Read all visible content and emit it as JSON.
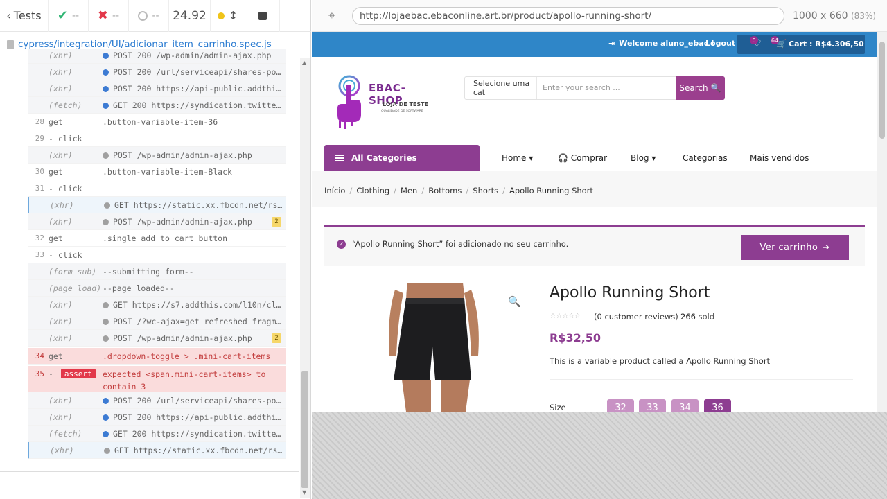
{
  "reporter": {
    "tests_label": "Tests",
    "passed": "--",
    "failed": "--",
    "pending": "--",
    "duration": "24.92",
    "spec_path": "cypress/integration/UI/adicionar_item_carrinho.spec.js",
    "rows": [
      {
        "num": "",
        "name": "(xhr)",
        "msg": "POST 200 /wp-admin/admin-ajax.php",
        "dot": "blue",
        "style": "grey"
      },
      {
        "num": "",
        "name": "(xhr)",
        "msg": "POST 200 /url/serviceapi/shares-post.json...",
        "dot": "blue",
        "style": "grey"
      },
      {
        "num": "",
        "name": "(xhr)",
        "msg": "POST 200 https://api-public.addthis.com/u...",
        "dot": "blue",
        "style": "grey"
      },
      {
        "num": "",
        "name": "(fetch)",
        "msg": "GET 200 https://syndication.twitte...",
        "dot": "blue",
        "style": "grey"
      },
      {
        "num": "28",
        "name": "get",
        "msg": ".button-variable-item-36",
        "dot": "",
        "style": "plain"
      },
      {
        "num": "29",
        "name": " - click",
        "msg": "",
        "dot": "",
        "style": "plain"
      },
      {
        "num": "",
        "name": "(xhr)",
        "msg": "POST /wp-admin/admin-ajax.php",
        "dot": "gray",
        "style": "grey"
      },
      {
        "num": "30",
        "name": "get",
        "msg": ".button-variable-item-Black",
        "dot": "",
        "style": "plain"
      },
      {
        "num": "31",
        "name": " - click",
        "msg": "",
        "dot": "",
        "style": "plain"
      },
      {
        "num": "",
        "name": "(xhr)",
        "msg": "GET https://static.xx.fbcdn.net/rs...",
        "dot": "gray",
        "style": "pending"
      },
      {
        "num": "",
        "name": "(xhr)",
        "msg": "POST /wp-admin/admin-ajax.php",
        "dot": "gray",
        "style": "grey",
        "badge": "2"
      },
      {
        "num": "32",
        "name": "get",
        "msg": ".single_add_to_cart_button",
        "dot": "",
        "style": "plain"
      },
      {
        "num": "33",
        "name": " - click",
        "msg": "",
        "dot": "",
        "style": "plain"
      },
      {
        "num": "",
        "name": "(form sub)",
        "msg": "--submitting form--",
        "dot": "",
        "style": "grey"
      },
      {
        "num": "",
        "name": "(page load)",
        "msg": "--page loaded--",
        "dot": "",
        "style": "grey"
      },
      {
        "num": "",
        "name": "(xhr)",
        "msg": "GET https://s7.addthis.com/l10n/cl...",
        "dot": "gray",
        "style": "grey"
      },
      {
        "num": "",
        "name": "(xhr)",
        "msg": "POST /?wc-ajax=get_refreshed_fragm...",
        "dot": "gray",
        "style": "grey"
      },
      {
        "num": "",
        "name": "(xhr)",
        "msg": "POST /wp-admin/admin-ajax.php",
        "dot": "gray",
        "style": "grey",
        "badge": "2"
      },
      {
        "num": "34",
        "name": "get",
        "msg": ".dropdown-toggle > .mini-cart-items",
        "dot": "",
        "style": "failed"
      },
      {
        "num": "35",
        "name": "- assert",
        "msg": "expected <span.mini-cart-items> to",
        "dot": "",
        "style": "failed"
      },
      {
        "num": "",
        "name": "",
        "msg": "contain 3",
        "dot": "",
        "style": "failed"
      },
      {
        "num": "",
        "name": "(xhr)",
        "msg": "POST 200 /url/serviceapi/shares-post.json...",
        "dot": "blue",
        "style": "grey"
      },
      {
        "num": "",
        "name": "(xhr)",
        "msg": "POST 200 https://api-public.addthis.com/u...",
        "dot": "blue",
        "style": "grey"
      },
      {
        "num": "",
        "name": "(fetch)",
        "msg": "GET 200 https://syndication.twitte...",
        "dot": "blue",
        "style": "grey"
      },
      {
        "num": "",
        "name": "(xhr)",
        "msg": "GET https://static.xx.fbcdn.net/rs...",
        "dot": "gray",
        "style": "pending"
      }
    ]
  },
  "browser": {
    "url": "http://lojaebac.ebaconline.art.br/product/apollo-running-short/",
    "viewport": "1000 x 660",
    "zoom": "(83%)"
  },
  "site": {
    "welcome": "Welcome aluno_ebac !",
    "logout": "Logout",
    "wishlist_count": "0",
    "cart_count": "64",
    "cart_label": "Cart : R$4.306,50",
    "logo_title": "EBAC-SHOP",
    "logo_sub": "LOJA DE TESTE",
    "logo_sub2": "QUALIDADE DE SOFTWARE",
    "search_category": "Selecione uma cat",
    "search_placeholder": "Enter your search ...",
    "search_button": "Search",
    "all_categories": "All Categories",
    "nav": [
      "Home ▾",
      "Comprar",
      "Blog ▾",
      "Categorias",
      "Mais vendidos"
    ],
    "breadcrumb": [
      "Início",
      "Clothing",
      "Men",
      "Bottoms",
      "Shorts",
      "Apollo Running Short"
    ],
    "notice_text": "“Apollo Running Short” foi adicionado no seu carrinho.",
    "ver_carrinho": "Ver carrinho",
    "product_title": "Apollo Running Short",
    "reviews": "(0 customer reviews)",
    "sold_count": "266",
    "sold_label": "sold",
    "price": "R$32,50",
    "description": "This is a variable product called a Apollo Running Short",
    "size_label": "Size",
    "sizes": [
      "32",
      "33",
      "34",
      "36"
    ]
  }
}
